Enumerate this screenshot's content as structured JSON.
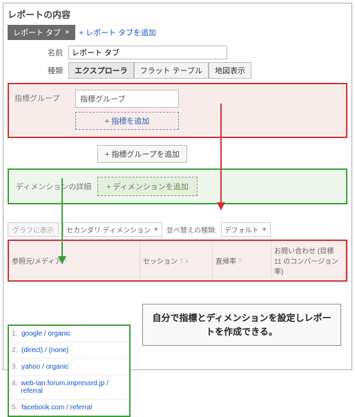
{
  "title": "レポートの内容",
  "tab": {
    "label": "レポート タブ",
    "close": "×"
  },
  "addTab": "+ レポート タブを追加",
  "nameLabel": "名前",
  "nameValue": "レポート タブ",
  "typeLabel": "種類",
  "typeButtons": {
    "explorer": "エクスプローラ",
    "flat": "フラット テーブル",
    "map": "地図表示"
  },
  "metricGroup": {
    "label": "指標グループ",
    "field": "指標グループ",
    "add": "+ 指標を追加"
  },
  "addGroup": "+ 指標グループを追加",
  "dimension": {
    "label": "ディメンションの詳細",
    "add": "+ ディメンションを追加"
  },
  "controls": {
    "graph": "グラフに表示",
    "secondary": "セカンダリ ディメンション",
    "sort": "並べ替えの種類:",
    "default": "デフォルト"
  },
  "headers": {
    "source": "参照元/メディア",
    "sessions": "セッション",
    "bounce": "直帰率",
    "goal": "お問い合わせ (目標 11 のコンバージョン率)"
  },
  "sources": [
    {
      "n": "1.",
      "t": "google / organic"
    },
    {
      "n": "2.",
      "t": "(direct) / (none)"
    },
    {
      "n": "3.",
      "t": "yahoo / organic"
    },
    {
      "n": "4.",
      "t": "web-tan.forum.impressrd.jp / referral"
    },
    {
      "n": "5.",
      "t": "facebook.com / referral"
    }
  ],
  "callout": "自分で指標とディメンションを設定しレポートを作成できる。"
}
